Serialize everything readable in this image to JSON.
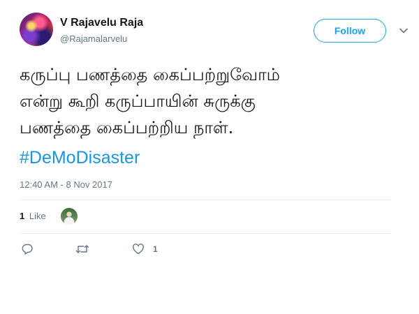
{
  "author": {
    "name": "V Rajavelu Raja",
    "handle": "@Rajamalarvelu",
    "follow_label": "Follow"
  },
  "tweet": {
    "lines": [
      "கருப்பு பணத்தை கைப்பற்றுவோம்",
      "என்று கூறி கருப்பாயின் சுருக்கு",
      "பணத்தை கைப்பற்றிய நாள்."
    ],
    "hashtag": "#DeMoDisaster",
    "timestamp": "12:40 AM - 8 Nov 2017"
  },
  "engagement": {
    "likes_count": "1",
    "likes_label": "Like"
  },
  "actions": {
    "like_count": "1"
  },
  "colors": {
    "accent": "#1da1f2",
    "hashtag": "#1b95e0",
    "muted": "#657786",
    "divider": "#e6ecf0"
  },
  "icons": [
    "chevron-down-icon",
    "reply-icon",
    "retweet-icon",
    "heart-icon"
  ]
}
